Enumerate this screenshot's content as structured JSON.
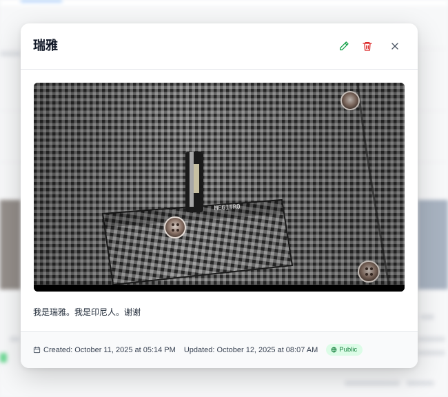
{
  "modal": {
    "title": "瑞雅",
    "description": "我是瑞雅。我是印尼人。谢谢",
    "image_alt": "checkered shirt with pocket and buttons"
  },
  "toolbar": {
    "edit_icon": "pencil-icon",
    "delete_icon": "trash-icon",
    "close_icon": "close-icon"
  },
  "footer": {
    "created": "Created: October 11, 2025 at 05:14 PM",
    "updated": "Updated: October 12, 2025 at 08:07 AM",
    "visibility": "Public"
  },
  "colors": {
    "edit": "#16a34a",
    "delete": "#dc2626",
    "close": "#4b5563",
    "badge_bg": "#dcfce7",
    "badge_text": "#15803d"
  }
}
